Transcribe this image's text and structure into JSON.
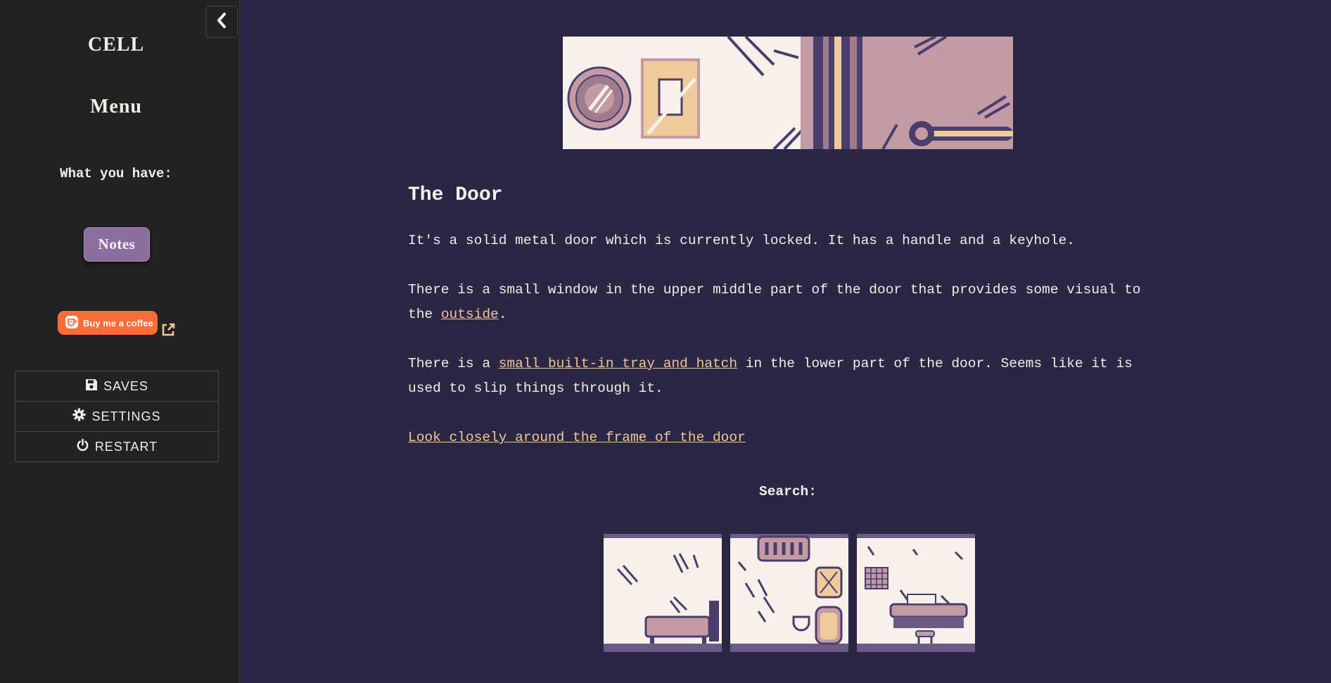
{
  "sidebar": {
    "game_title": "CELL",
    "menu_title": "Menu",
    "inventory_heading": "What you have:",
    "inventory": {
      "notes_label": "Notes"
    },
    "coffee": {
      "label": "Buy me a coffee",
      "accent": "#ff6d36"
    },
    "menu": [
      {
        "label": "SAVES",
        "icon": "floppy-disk-icon"
      },
      {
        "label": "SETTINGS",
        "icon": "gear-icon"
      },
      {
        "label": "RESTART",
        "icon": "power-icon"
      }
    ]
  },
  "passage": {
    "title": "The Door",
    "p1": "It's a solid metal door which is currently locked. It has a handle and a keyhole.",
    "p2_before": "There is a small window in the upper middle part of the door that provides some visual to the ",
    "p2_link": "outside",
    "p2_after": ".",
    "p3_before": "There is a ",
    "p3_link": "small built-in tray and hatch",
    "p3_after": " in the lower part of the door. Seems like it is used to slip things through it.",
    "p4_link": "Look closely around the frame of the door"
  },
  "search": {
    "label": "Search:",
    "thumbnails": [
      "bed-area",
      "toilet-area",
      "desk-area"
    ]
  },
  "colors": {
    "page_bg": "#292744",
    "sidebar_bg": "#222222",
    "link": "#f3c59b",
    "notes_button": "#8a6fa0",
    "pixel_light": "#f7f1ea",
    "pixel_dark": "#4a3e6e",
    "pixel_pink": "#c49aa4",
    "pixel_tan": "#efca9a"
  }
}
